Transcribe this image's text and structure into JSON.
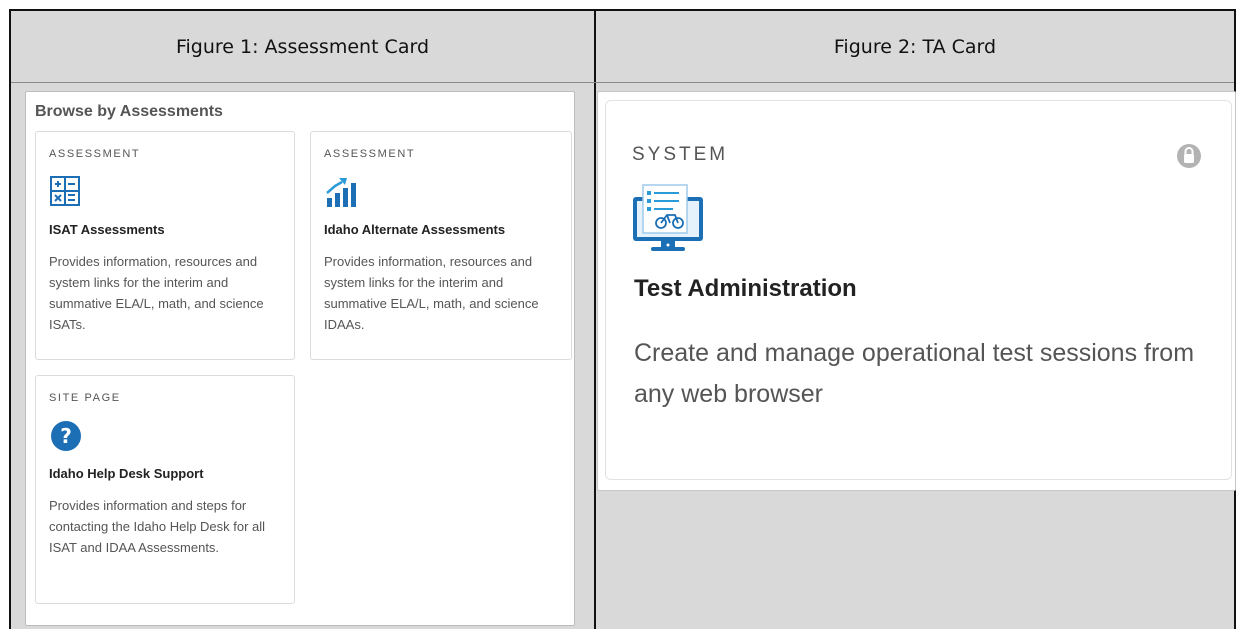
{
  "figure1": {
    "header": "Figure 1: Assessment Card",
    "browse_title": "Browse by Assessments",
    "cards": [
      {
        "eyebrow": "ASSESSMENT",
        "icon": "calculator-icon",
        "title": "ISAT Assessments",
        "desc": "Provides information, resources and system links for the interim and summative ELA/L, math, and science ISATs."
      },
      {
        "eyebrow": "ASSESSMENT",
        "icon": "bar-chart-growth-icon",
        "title": "Idaho Alternate Assessments",
        "desc": "Provides information, resources and system links for the interim and summative ELA/L, math, and science IDAAs."
      },
      {
        "eyebrow": "SITE PAGE",
        "icon": "question-icon",
        "title": "Idaho Help Desk Support",
        "desc": "Provides information and steps for contacting the Idaho Help Desk for all ISAT and IDAA Assessments."
      }
    ]
  },
  "figure2": {
    "header": "Figure 2: TA Card",
    "card": {
      "eyebrow": "SYSTEM",
      "lock_icon": "lock-icon",
      "icon": "monitor-checklist-icon",
      "title": "Test Administration",
      "desc": "Create and manage operational test sessions from any web browser"
    }
  },
  "colors": {
    "accent_blue": "#1c6fb5",
    "icon_light_blue": "#2b9ad8",
    "grey_background": "#d9d9d9"
  }
}
